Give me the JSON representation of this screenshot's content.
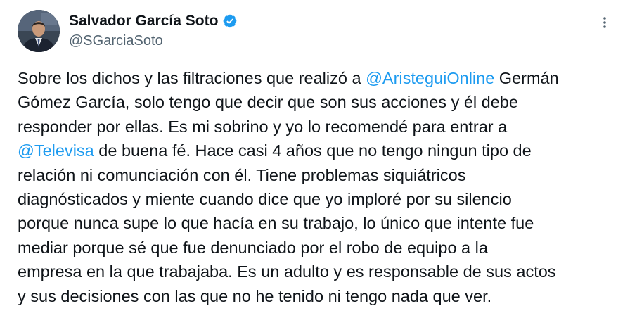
{
  "author": {
    "display_name": "Salvador García Soto",
    "handle": "@SGarciaSoto",
    "verified": true,
    "avatar_icon": "profile-photo"
  },
  "icons": {
    "verified": "verified-badge-icon",
    "more": "more-options-icon"
  },
  "colors": {
    "mention": "#1d9bf0",
    "verified_badge": "#1d9bf0",
    "text": "#0f1419",
    "secondary": "#536471"
  },
  "tweet": {
    "lines": [
      {
        "pre": "Sobre los dichos y las filtraciones que realizó a ",
        "mention": "@AristeguiOnline",
        "post": " Germán"
      },
      {
        "pre": "Gómez García, solo tengo que decir que son sus acciones y él  debe"
      },
      {
        "pre": "responder por ellas. Es mi sobrino y yo lo recomendé para entrar a"
      },
      {
        "pre": "",
        "mention": "@Televisa",
        "post": " de buena fé. Hace casi 4 años que no tengo ningun tipo de"
      },
      {
        "pre": "relación ni comunciación con él. Tiene problemas siquiátricos"
      },
      {
        "pre": "diagnósticados y miente cuando dice que yo imploré por su silencio"
      },
      {
        "pre": "porque nunca supe lo que hacía en su trabajo, lo único que intente fue"
      },
      {
        "pre": "mediar porque sé que fue denunciado por el robo de equipo a la"
      },
      {
        "pre": "empresa en la que trabajaba. Es un adulto y es responsable de sus actos"
      },
      {
        "pre": "y sus decisiones con las que no he tenido ni tengo nada que ver."
      }
    ]
  }
}
